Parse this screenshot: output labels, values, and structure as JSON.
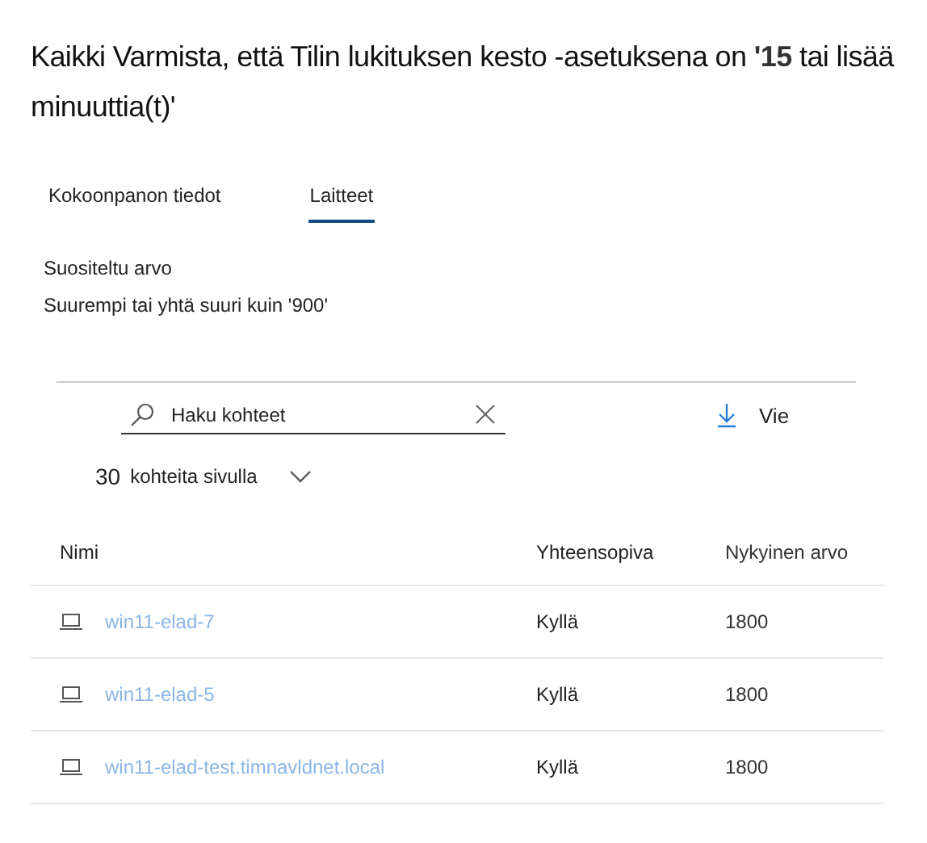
{
  "title": "Kaikki Varmista, että Tilin lukituksen kesto -asetuksena on **'15** tai lisää minuuttia(t)'",
  "tabs": [
    {
      "label": "Kokoonpanon tiedot",
      "selected": false
    },
    {
      "label": "Laitteet",
      "selected": true
    }
  ],
  "recommended": {
    "label": "Suositeltu arvo",
    "value": "Suurempi tai yhtä suuri kuin '900'"
  },
  "search": {
    "value": "Haku kohteet"
  },
  "export": {
    "label": "Vie"
  },
  "page_size": {
    "count": "30",
    "label": "kohteita sivulla"
  },
  "table": {
    "columns": [
      "Nimi",
      "Yhteensopiva",
      "Nykyinen arvo"
    ],
    "rows": [
      {
        "name": "win11-elad-7",
        "compliant": "Kyllä",
        "value": "1800"
      },
      {
        "name": "win11-elad-5",
        "compliant": "Kyllä",
        "value": "1800"
      },
      {
        "name": "win11-elad-test.timnavldnet.local",
        "compliant": "Kyllä",
        "value": "1800"
      }
    ]
  }
}
